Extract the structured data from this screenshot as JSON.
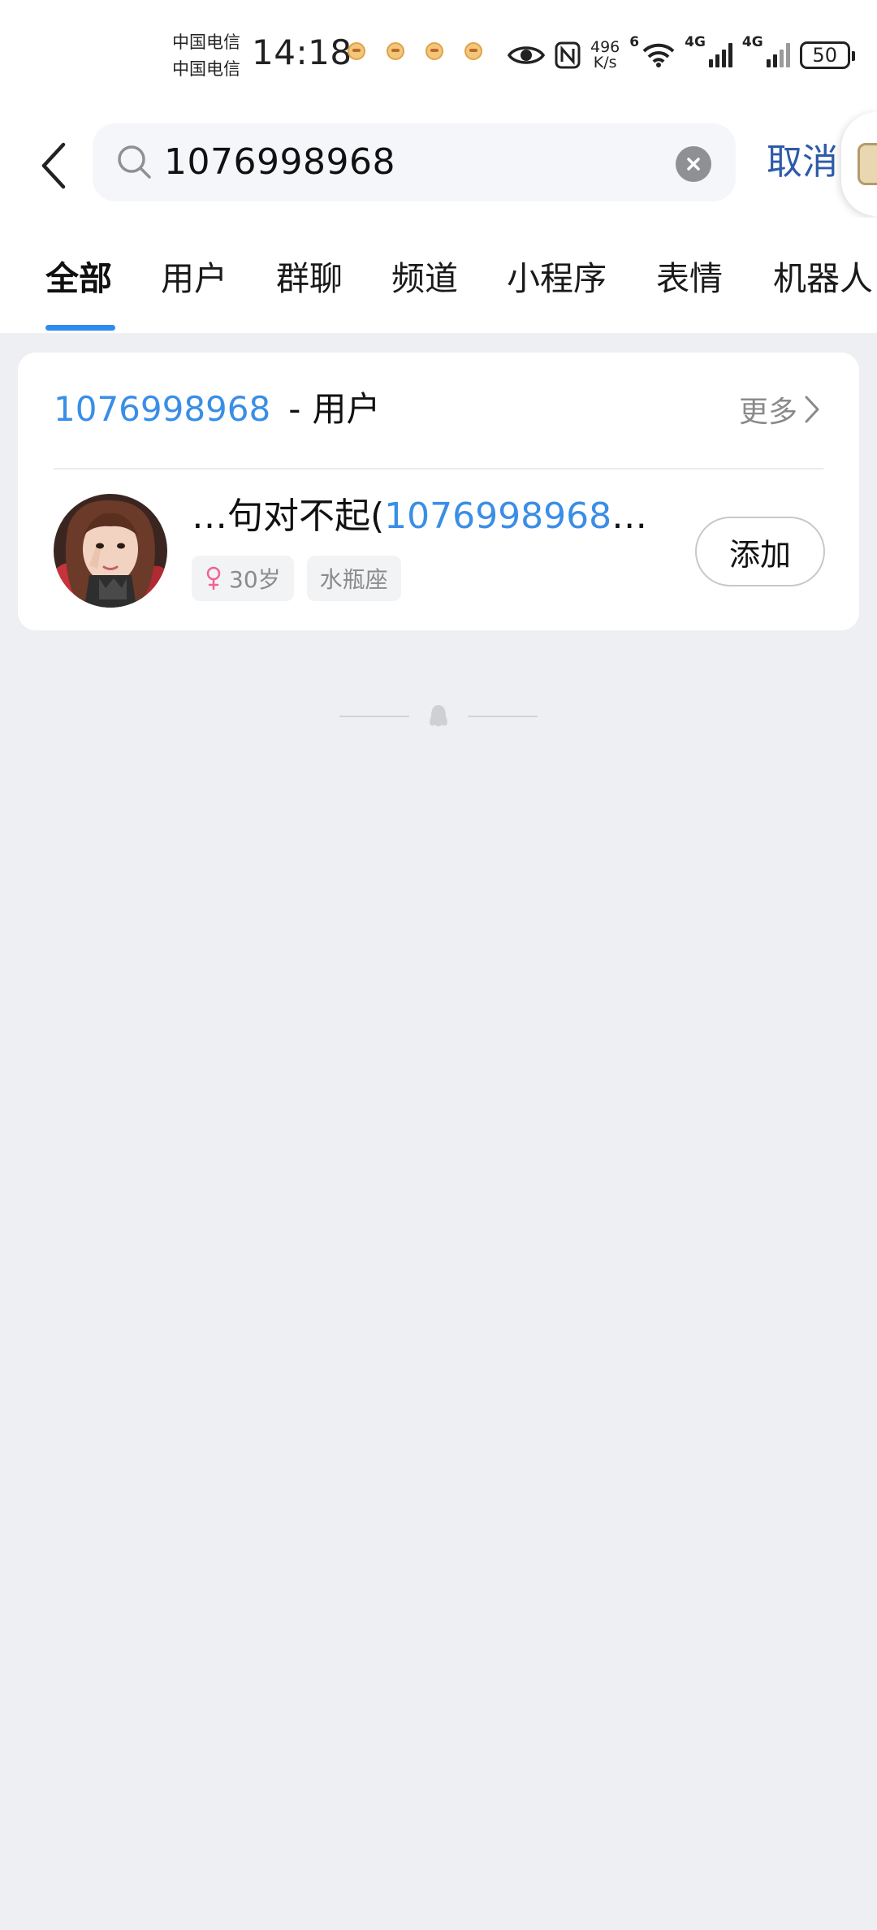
{
  "status_bar": {
    "carrier_1": "中国电信",
    "carrier_2": "中国电信",
    "time": "14:18",
    "net_speed_value": "496",
    "net_speed_unit": "K/s",
    "wifi_badge": "6",
    "network_1": "4G",
    "network_2": "4G",
    "battery": "50"
  },
  "search": {
    "query": "1076998968",
    "cancel_label": "取消"
  },
  "tabs": [
    {
      "label": "全部",
      "active": true
    },
    {
      "label": "用户",
      "active": false
    },
    {
      "label": "群聊",
      "active": false
    },
    {
      "label": "频道",
      "active": false
    },
    {
      "label": "小程序",
      "active": false
    },
    {
      "label": "表情",
      "active": false
    },
    {
      "label": "机器人",
      "active": false
    }
  ],
  "results": {
    "section_keyword": "1076998968",
    "section_separator": "-",
    "section_category": "用户",
    "more_label": "更多",
    "user": {
      "name_prefix": "…句对不起(",
      "name_highlight": "1076998968",
      "name_suffix": "…",
      "age_tag": "30岁",
      "zodiac_tag": "水瓶座",
      "add_label": "添加"
    }
  },
  "colors": {
    "accent_blue": "#2D8CF0",
    "highlight_blue": "#3A8EE6",
    "cancel_blue": "#2E5BA8",
    "background": "#EEEFF2",
    "gender_pink": "#F06292"
  }
}
